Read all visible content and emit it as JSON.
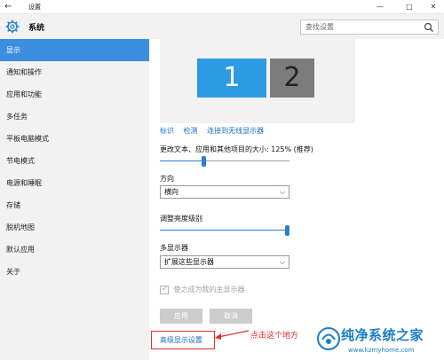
{
  "window": {
    "back_glyph": "←",
    "title": "设置",
    "controls": {
      "minimize": "—",
      "maximize": "□",
      "close": "✕"
    }
  },
  "header": {
    "title": "系统",
    "search": {
      "value": "查找设置",
      "placeholder": "查找设置"
    }
  },
  "sidebar": {
    "items": [
      {
        "label": "显示",
        "active": true
      },
      {
        "label": "通知和操作"
      },
      {
        "label": "应用和功能"
      },
      {
        "label": "多任务"
      },
      {
        "label": "平板电脑模式"
      },
      {
        "label": "节电模式"
      },
      {
        "label": "电源和睡眠"
      },
      {
        "label": "存储"
      },
      {
        "label": "脱机地图"
      },
      {
        "label": "默认应用"
      },
      {
        "label": "关于"
      }
    ]
  },
  "display": {
    "monitors": [
      "1",
      "2"
    ],
    "links": [
      "标识",
      "检测",
      "连接到无线显示器"
    ],
    "scale_label": "更改文本、应用和其他项目的大小: 125% (推荐)",
    "scale_value": 0.33,
    "orientation_label": "方向",
    "orientation_value": "横向",
    "brightness_label": "调整亮度级别",
    "brightness_value": 1.0,
    "multi_label": "多显示器",
    "multi_value": "扩展这些显示器",
    "main_display_label": "使之成为我的主显示器",
    "apply_label": "应用",
    "cancel_label": "取消",
    "advanced_label": "高级显示设置"
  },
  "annotation": {
    "text": "点击这个地方"
  },
  "watermark": {
    "title": "纯净系统之家",
    "url": "www.kzmyhome.com"
  },
  "colors": {
    "accent": "#3b8fde",
    "monitor_primary": "#2d9ae4",
    "monitor_secondary": "#7c7c7c",
    "annotation": "#e22b2b"
  }
}
